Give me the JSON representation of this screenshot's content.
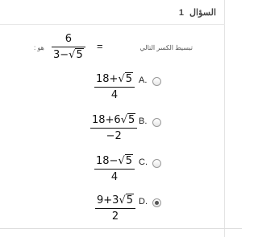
{
  "question": {
    "title_word": "السؤال",
    "number": "1",
    "stem_text": "تبسيط الكسر التالي",
    "stem_equals": "=",
    "stem_is": "هو :",
    "stem_fraction": {
      "numerator": "6",
      "denominator_prefix": "3−",
      "denominator_radical": "5"
    }
  },
  "options": [
    {
      "letter": "A.",
      "num_prefix": "18+",
      "num_radical": "5",
      "num_suffix": "",
      "den": "4",
      "selected": false
    },
    {
      "letter": "B.",
      "num_prefix": "18+6",
      "num_radical": "5",
      "num_suffix": "",
      "den": "−2",
      "selected": false
    },
    {
      "letter": "C.",
      "num_prefix": "18−",
      "num_radical": "5",
      "num_suffix": "",
      "den": "4",
      "selected": false
    },
    {
      "letter": "D.",
      "num_prefix": "9+3",
      "num_radical": "5",
      "num_suffix": "",
      "den": "2",
      "selected": true
    }
  ]
}
